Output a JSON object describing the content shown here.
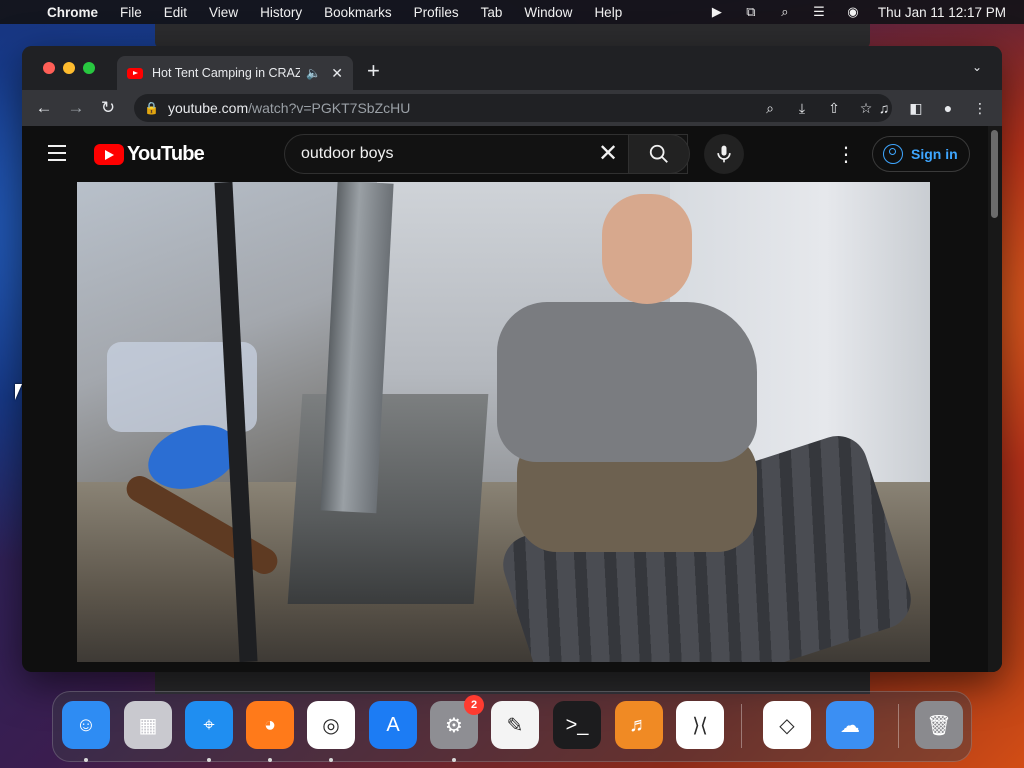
{
  "menubar": {
    "app_name": "Chrome",
    "items": [
      "File",
      "Edit",
      "View",
      "History",
      "Bookmarks",
      "Profiles",
      "Tab",
      "Window",
      "Help"
    ],
    "clock": "Thu Jan 11  12:17 PM"
  },
  "browser": {
    "tab": {
      "title": "Hot Tent Camping in CRAZ",
      "audio_playing": true
    },
    "address": {
      "host": "youtube.com",
      "path": "/watch?v=PGKT7SbZcHU"
    }
  },
  "youtube": {
    "logo_text": "YouTube",
    "search": {
      "value": "outdoor boys"
    },
    "sign_in_label": "Sign in"
  },
  "dock": {
    "apps": [
      {
        "name": "Finder",
        "icon": "finder-icon",
        "color": "#2e8cf3",
        "running": true
      },
      {
        "name": "Launchpad",
        "icon": "launchpad-icon",
        "color": "#c9c9cf",
        "running": false
      },
      {
        "name": "Safari",
        "icon": "safari-icon",
        "color": "#1f8ef1",
        "running": true
      },
      {
        "name": "Firefox",
        "icon": "firefox-icon",
        "color": "#ff7a1a",
        "running": true
      },
      {
        "name": "Chrome",
        "icon": "chrome-icon",
        "color": "#ffffff",
        "running": true
      },
      {
        "name": "App Store",
        "icon": "app-store-icon",
        "color": "#1c7cf4",
        "running": false
      },
      {
        "name": "System Settings",
        "icon": "system-settings-icon",
        "color": "#8e8e93",
        "running": true,
        "badge": "2"
      },
      {
        "name": "TextEdit",
        "icon": "textedit-icon",
        "color": "#f4f4f4",
        "running": false
      },
      {
        "name": "Terminal",
        "icon": "terminal-icon",
        "color": "#1c1c1e",
        "running": false
      },
      {
        "name": "GarageBand",
        "icon": "garageband-icon",
        "color": "#f08a24",
        "running": false
      },
      {
        "name": "Visual Studio Code",
        "icon": "vscode-icon",
        "color": "#ffffff",
        "running": false
      },
      {
        "name": "Visual Studio",
        "icon": "visual-studio-icon",
        "color": "#ffffff",
        "running": false
      },
      {
        "name": "Weather",
        "icon": "weather-icon",
        "color": "#3b8ff3",
        "running": false
      },
      {
        "name": "Trash",
        "icon": "trash-icon",
        "color": "#8a8a8e",
        "running": false
      }
    ]
  }
}
